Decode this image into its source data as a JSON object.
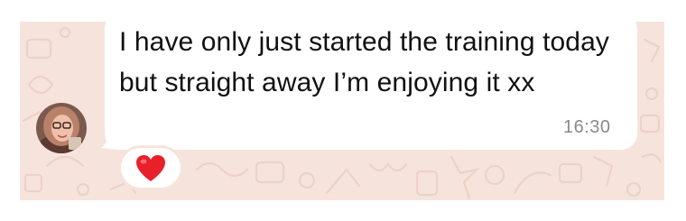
{
  "message": {
    "text": "I have only just started the training today but straight away I’m enjoying it xx",
    "time": "16:30",
    "reaction_icon": "red-heart",
    "reaction_color": "#e8202a",
    "avatar_icon": "contact-avatar"
  },
  "theme": {
    "wallpaper_color": "#f6e4dc",
    "bubble_color": "#ffffff",
    "timestamp_color": "#8a8a8a"
  }
}
